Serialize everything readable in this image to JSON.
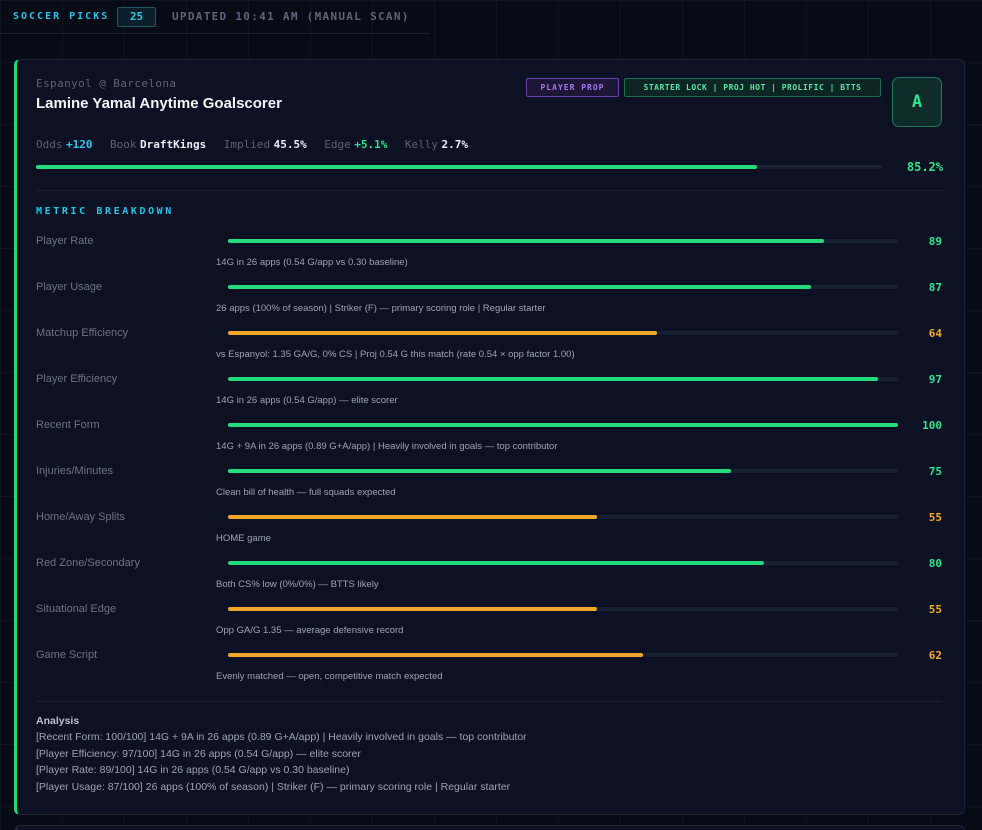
{
  "header": {
    "title": "SOCCER PICKS",
    "count": "25",
    "updated": "UPDATED 10:41 AM (MANUAL SCAN)"
  },
  "pick": {
    "matchup": "Espanyol @ Barcelona",
    "title": "Lamine Yamal Anytime Goalscorer",
    "prop_badge": "PLAYER PROP",
    "tags_badge": "STARTER LOCK | PROJ HOT | PROLIFIC | BTTS",
    "grade": "A",
    "stats": {
      "odds_label": "Odds",
      "odds": "+120",
      "book_label": "Book",
      "book": "DraftKings",
      "implied_label": "Implied",
      "implied": "45.5%",
      "edge_label": "Edge",
      "edge": "+5.1%",
      "kelly_label": "Kelly",
      "kelly": "2.7%"
    },
    "confidence": 85.2,
    "confidence_label": "85.2%"
  },
  "breakdown": {
    "title": "METRIC BREAKDOWN",
    "metrics": [
      {
        "label": "Player Rate",
        "value": 89,
        "color": "green",
        "note": "14G in 26 apps (0.54 G/app vs 0.30 baseline)"
      },
      {
        "label": "Player Usage",
        "value": 87,
        "color": "green",
        "note": "26 apps (100% of season) | Striker (F) — primary scoring role | Regular starter"
      },
      {
        "label": "Matchup Efficiency",
        "value": 64,
        "color": "amber",
        "note": "vs Espanyol: 1.35 GA/G, 0% CS | Proj 0.54 G this match (rate 0.54 × opp factor 1.00)"
      },
      {
        "label": "Player Efficiency",
        "value": 97,
        "color": "green",
        "note": "14G in 26 apps (0.54 G/app) — elite scorer"
      },
      {
        "label": "Recent Form",
        "value": 100,
        "color": "green",
        "note": "14G + 9A in 26 apps (0.89 G+A/app) | Heavily involved in goals — top contributor"
      },
      {
        "label": "Injuries/Minutes",
        "value": 75,
        "color": "green",
        "note": "Clean bill of health — full squads expected"
      },
      {
        "label": "Home/Away Splits",
        "value": 55,
        "color": "amber",
        "note": "HOME game"
      },
      {
        "label": "Red Zone/Secondary",
        "value": 80,
        "color": "green",
        "note": "Both CS% low (0%/0%) — BTTS likely"
      },
      {
        "label": "Situational Edge",
        "value": 55,
        "color": "amber",
        "note": "Opp GA/G 1.35 — average defensive record"
      },
      {
        "label": "Game Script",
        "value": 62,
        "color": "amber",
        "note": "Evenly matched — open, competitive match expected"
      }
    ]
  },
  "analysis": {
    "title": "Analysis",
    "lines": [
      "[Recent Form: 100/100] 14G + 9A in 26 apps (0.89 G+A/app) | Heavily involved in goals — top contributor",
      "[Player Efficiency: 97/100] 14G in 26 apps (0.54 G/app) — elite scorer",
      "[Player Rate: 89/100] 14G in 26 apps (0.54 G/app vs 0.30 baseline)",
      "[Player Usage: 87/100] 26 apps (100% of season) | Striker (F) — primary scoring role | Regular starter"
    ]
  },
  "colors": {
    "accent_cyan": "#22c4e8",
    "accent_green": "#25d97d",
    "accent_amber": "#f2a82c",
    "accent_purple": "#a877f0"
  }
}
